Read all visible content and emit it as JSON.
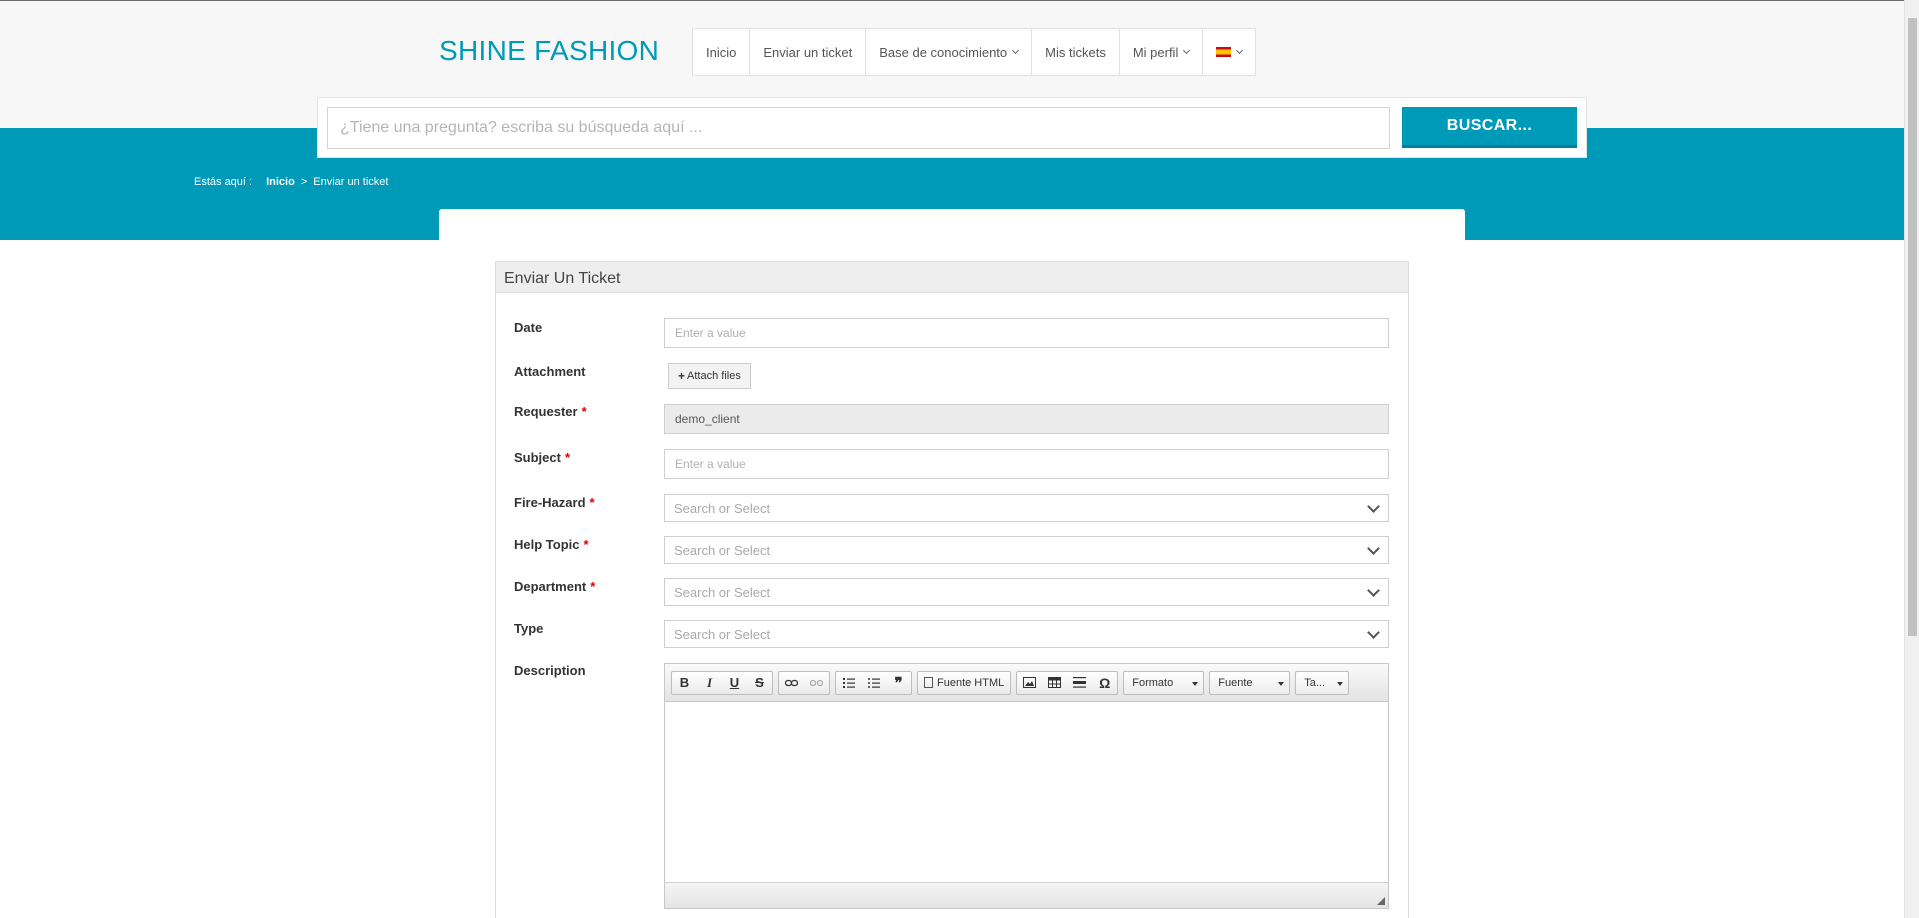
{
  "brand": {
    "logo": "SHINE FASHION"
  },
  "nav": {
    "items": [
      {
        "label": "Inicio",
        "dropdown": false
      },
      {
        "label": "Enviar un ticket",
        "dropdown": false
      },
      {
        "label": "Base de conocimiento",
        "dropdown": true
      },
      {
        "label": "Mis tickets",
        "dropdown": false
      },
      {
        "label": "Mi perfil",
        "dropdown": true
      }
    ],
    "language_icon": "spain-flag-icon"
  },
  "search": {
    "placeholder": "¿Tiene una pregunta? escriba su búsqueda aquí ...",
    "button_label": "BUSCAR..."
  },
  "breadcrumb": {
    "prefix": "Estás aquí :",
    "home": "Inicio",
    "separator": ">",
    "current": "Enviar un ticket"
  },
  "form": {
    "title": "Enviar Un Ticket",
    "date": {
      "label": "Date",
      "placeholder": "Enter a value"
    },
    "attachment": {
      "label": "Attachment",
      "button_label": "Attach files"
    },
    "requester": {
      "label": "Requester",
      "value": "demo_client",
      "required_mark": "*"
    },
    "subject": {
      "label": "Subject",
      "placeholder": "Enter a value",
      "required_mark": "*"
    },
    "fire_hazard": {
      "label": "Fire-Hazard",
      "placeholder": "Search or Select",
      "required_mark": "*"
    },
    "help_topic": {
      "label": "Help Topic",
      "placeholder": "Search or Select",
      "required_mark": "*"
    },
    "department": {
      "label": "Department",
      "placeholder": "Search or Select",
      "required_mark": "*"
    },
    "type": {
      "label": "Type",
      "placeholder": "Search or Select"
    },
    "description": {
      "label": "Description",
      "toolbar": {
        "bold": "B",
        "italic": "I",
        "underline": "U",
        "strike": "S",
        "blockquote": "❞",
        "source_label": "Fuente HTML",
        "special_char": "Ω",
        "format_label": "Formato",
        "font_label": "Fuente",
        "size_label": "Ta..."
      }
    }
  },
  "colors": {
    "accent": "#009ab9",
    "header_bg": "#f7f7f7",
    "required": "#dd0000"
  }
}
